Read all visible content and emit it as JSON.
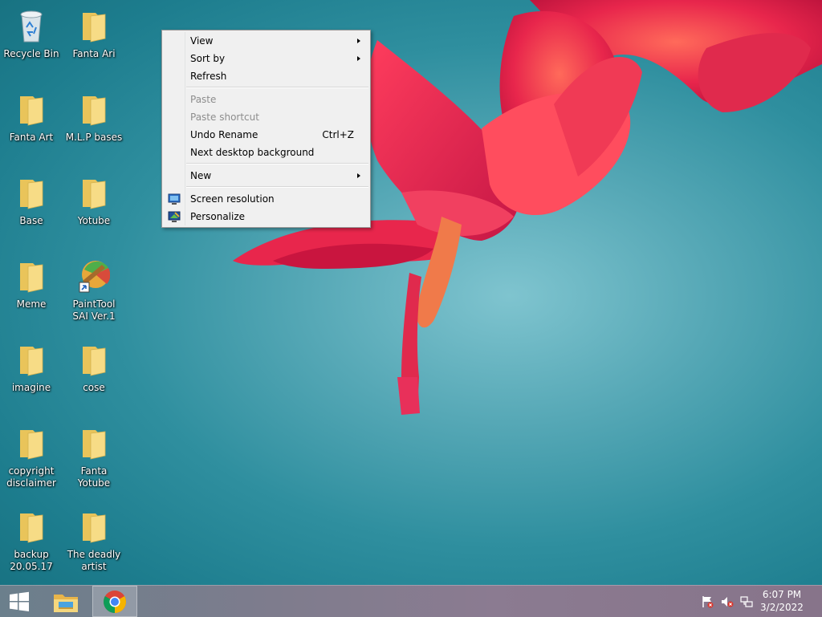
{
  "desktop": {
    "icons": [
      {
        "label": "Recycle Bin",
        "icon": "recycle-bin-icon"
      },
      {
        "label": "Fanta Ari",
        "icon": "folder-icon"
      },
      {
        "label": "Fanta Art",
        "icon": "folder-icon"
      },
      {
        "label": "M.L.P bases",
        "icon": "folder-icon"
      },
      {
        "label": "Base",
        "icon": "folder-icon"
      },
      {
        "label": "Yotube",
        "icon": "folder-icon"
      },
      {
        "label": "Meme",
        "icon": "folder-icon"
      },
      {
        "label": "PaintTool SAI Ver.1",
        "icon": "painttool-sai-icon"
      },
      {
        "label": "imagine",
        "icon": "folder-icon"
      },
      {
        "label": "cose",
        "icon": "folder-icon"
      },
      {
        "label": "copyright disclaimer",
        "icon": "folder-icon"
      },
      {
        "label": "Fanta Yotube",
        "icon": "folder-icon"
      },
      {
        "label": "backup 20.05.17",
        "icon": "folder-icon"
      },
      {
        "label": "The deadly artist",
        "icon": "folder-icon"
      }
    ]
  },
  "context_menu": {
    "items": [
      {
        "label": "View",
        "submenu": true,
        "enabled": true
      },
      {
        "label": "Sort by",
        "submenu": true,
        "enabled": true
      },
      {
        "label": "Refresh",
        "enabled": true
      },
      {
        "label": "Paste",
        "enabled": false
      },
      {
        "label": "Paste shortcut",
        "enabled": false
      },
      {
        "label": "Undo Rename",
        "shortcut": "Ctrl+Z",
        "enabled": true
      },
      {
        "label": "Next desktop background",
        "enabled": true
      },
      {
        "label": "New",
        "submenu": true,
        "enabled": true
      },
      {
        "label": "Screen resolution",
        "icon": "screen-resolution-icon",
        "enabled": true
      },
      {
        "label": "Personalize",
        "icon": "personalize-icon",
        "enabled": true
      }
    ]
  },
  "taskbar": {
    "start_icon": "windows-logo-icon",
    "pinned": [
      {
        "name": "file-explorer",
        "icon": "file-explorer-icon"
      },
      {
        "name": "google-chrome",
        "icon": "chrome-icon",
        "active": true
      }
    ],
    "tray": {
      "icons": [
        "action-center-flag-icon",
        "volume-muted-icon",
        "network-icon"
      ],
      "time": "6:07 PM",
      "date": "3/2/2022"
    }
  },
  "colors": {
    "wallpaper_teal": "#2f8f9f",
    "flower_red": "#e0244a",
    "menu_bg": "#f0f0f0",
    "folder_yellow": "#f5d77d"
  }
}
